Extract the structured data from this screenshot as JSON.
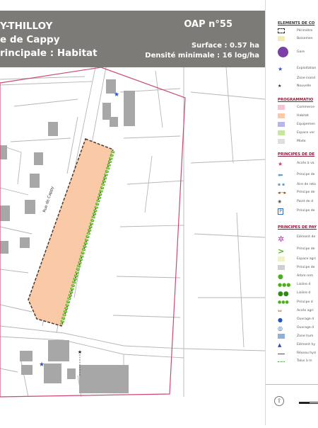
{
  "header": {
    "title_line1": "Y-THILLOY",
    "title_line2": "e de Cappy",
    "title_line3": "rincipale : Habitat",
    "oap": "OAP n°55",
    "surface": "Surface : 0.57 ha",
    "density": "Densité minimale : 16 log/ha"
  },
  "map": {
    "street_label": "Rue de Cappy"
  },
  "legend": {
    "section1_title": "ELEMENTS DE CO",
    "section1_items": [
      {
        "icon": "dashed-rectangle-icon",
        "label": "Périmètre"
      },
      {
        "icon": "yellow-rectangle-icon",
        "label": "Boisemen"
      },
      {
        "icon": "train-station-icon",
        "label": "Gare"
      },
      {
        "icon": "blue-star-icon",
        "label": "Exploitation"
      },
      {
        "icon": "empty-icon",
        "label": "Zone inond"
      },
      {
        "icon": "black-star-icon",
        "label": "Nouvelle"
      }
    ],
    "section2_title": "PROGRAMMATIO",
    "section2_items": [
      {
        "color": "#f2c6d8",
        "label": "Commerce"
      },
      {
        "color": "#f9c9a8",
        "label": "Habitat"
      },
      {
        "color": "#b6b6e8",
        "label": "Equipemen"
      },
      {
        "color": "#c6e89e",
        "label": "Espace ver"
      },
      {
        "color": "#dedede",
        "label": "Mixte"
      }
    ],
    "section3_title": "PRINCIPES DE DE",
    "section3_items": [
      {
        "icon": "pink-star-icon",
        "label": "Accès à va"
      },
      {
        "icon": "blue-arrow-icon",
        "label": "Principe de"
      },
      {
        "icon": "blue-dots-icon",
        "label": "Aire de reto"
      },
      {
        "icon": "double-arrow-icon",
        "label": "Principe de"
      },
      {
        "icon": "point-icon",
        "label": "Point de d"
      },
      {
        "icon": "parking-icon",
        "label": "Principe de"
      }
    ],
    "section4_title": "PRINCIPES DE PAY",
    "section4_items": [
      {
        "icon": "asterisk-icon",
        "label": "Elément de"
      },
      {
        "icon": "green-chevron-icon",
        "label": "Principe de"
      },
      {
        "icon": "light-green-rect-icon",
        "label": "Espace agri"
      },
      {
        "icon": "grey-rect-icon",
        "label": "Principe de"
      },
      {
        "icon": "green-circle-icon",
        "label": "Arbre rem"
      },
      {
        "icon": "green-dots-line-icon",
        "label": "Lisière d"
      },
      {
        "icon": "double-green-circle-icon",
        "label": "Lisière d"
      },
      {
        "icon": "triple-green-circle-icon",
        "label": "Principe d"
      },
      {
        "icon": "brown-arrow-icon",
        "label": "Accès agri"
      },
      {
        "icon": "blue-circle-icon",
        "label": "Ouvrage d"
      },
      {
        "icon": "blue-circle-outline-icon",
        "label": "Ouvrage d"
      },
      {
        "icon": "blue-rect-icon",
        "label": "Zone hum"
      },
      {
        "icon": "blue-triangle-icon",
        "label": "Elément hy"
      },
      {
        "icon": "blue-line-icon",
        "label": "Réseau hyd"
      },
      {
        "icon": "dotted-line-icon",
        "label": "Talus à m"
      }
    ]
  }
}
